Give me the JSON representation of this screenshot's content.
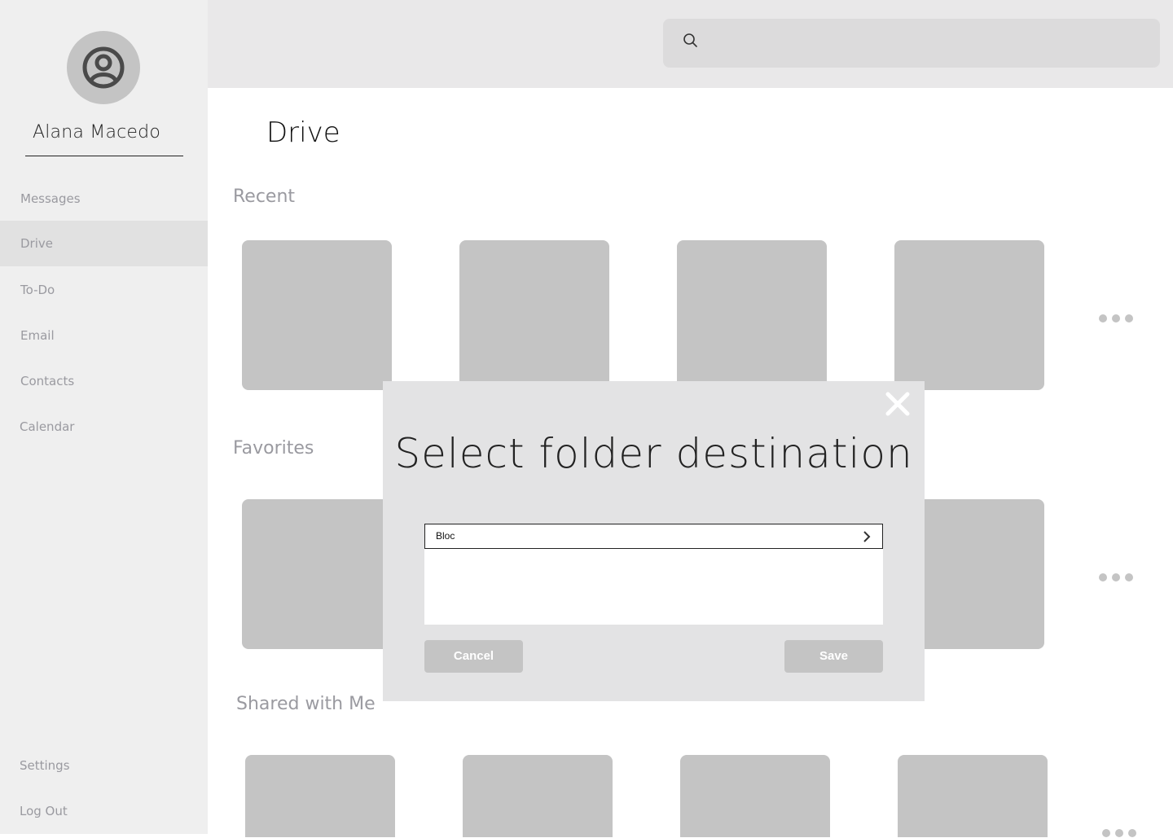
{
  "user": {
    "name": "Alana Macedo"
  },
  "sidebar": {
    "items": [
      {
        "label": "Messages"
      },
      {
        "label": "Drive"
      },
      {
        "label": "To-Do"
      },
      {
        "label": "Email"
      },
      {
        "label": "Contacts"
      },
      {
        "label": "Calendar"
      }
    ],
    "bottom": [
      {
        "label": "Settings"
      },
      {
        "label": "Log Out"
      }
    ],
    "active": "Drive"
  },
  "search": {
    "placeholder": "",
    "icon": "search-icon"
  },
  "main": {
    "title": "Drive",
    "sections": [
      {
        "title": "Recent"
      },
      {
        "title": "Favorites"
      },
      {
        "title": "Shared with Me"
      }
    ]
  },
  "modal": {
    "title": "Select folder destination",
    "folder": "Bloc",
    "cancel_label": "Cancel",
    "save_label": "Save"
  },
  "colors": {
    "sidebar_bg": "#efefef",
    "active_item_bg": "#e1e1e1",
    "topbar_bg": "#e9e8e9",
    "tile": "#c4c4c4",
    "modal_bg": "#e3e3e4",
    "muted_text": "#9a9aa0"
  }
}
